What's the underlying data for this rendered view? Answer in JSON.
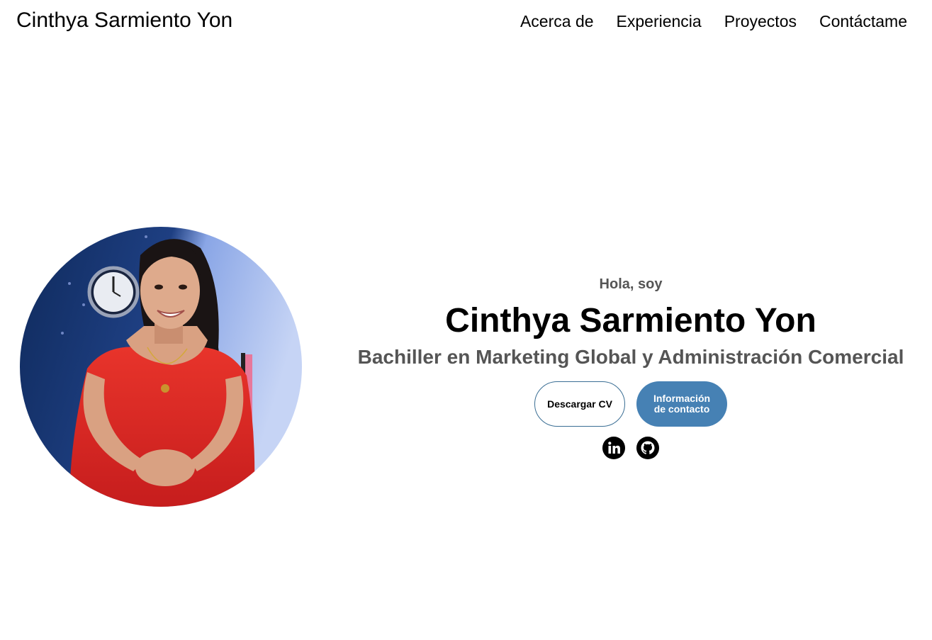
{
  "nav": {
    "logo": "Cinthya Sarmiento Yon",
    "links": [
      {
        "label": "Acerca de"
      },
      {
        "label": "Experiencia"
      },
      {
        "label": "Proyectos"
      },
      {
        "label": "Contáctame"
      }
    ]
  },
  "hero": {
    "greeting": "Hola, soy",
    "name": "Cinthya Sarmiento Yon",
    "subtitle": "Bachiller en Marketing Global y Administración Comercial",
    "buttons": {
      "cv": "Descargar CV",
      "contact": "Información de contacto"
    },
    "socials": [
      {
        "icon": "linkedin-icon"
      },
      {
        "icon": "github-icon"
      }
    ]
  },
  "colors": {
    "accent": "#4681b4",
    "outline": "#3a6e94",
    "muted_text": "#555555"
  }
}
